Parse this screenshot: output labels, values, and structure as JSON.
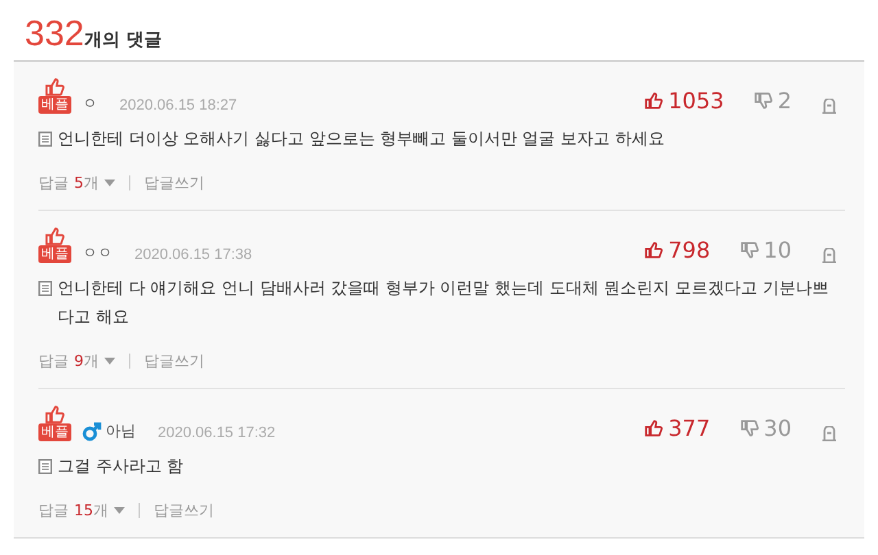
{
  "header": {
    "count": "332",
    "label": "개의 댓글"
  },
  "comments": [
    {
      "best": true,
      "badge": "베플",
      "nickname": "ㅇ",
      "male": false,
      "date": "2020.06.15 18:27",
      "likes": "1053",
      "dislikes": "2",
      "text": "언니한테 더이상 오해사기 싫다고 앞으로는 형부빼고 둘이서만 얼굴 보자고 하세요",
      "replies_label": "답글",
      "replies_count": "5",
      "replies_unit": "개",
      "write_reply": "답글쓰기"
    },
    {
      "best": true,
      "badge": "베플",
      "nickname": "ㅇㅇ",
      "male": false,
      "date": "2020.06.15 17:38",
      "likes": "798",
      "dislikes": "10",
      "text": "언니한테 다 얘기해요 언니 담배사러 갔을때 형부가 이런말 했는데 도대체 뭔소린지 모르겠다고 기분나쁘다고 해요",
      "replies_label": "답글",
      "replies_count": "9",
      "replies_unit": "개",
      "write_reply": "답글쓰기"
    },
    {
      "best": true,
      "badge": "베플",
      "nickname": "아님",
      "male": true,
      "date": "2020.06.15 17:32",
      "likes": "377",
      "dislikes": "30",
      "text": "그걸 주사라고 함",
      "replies_label": "답글",
      "replies_count": "15",
      "replies_unit": "개",
      "write_reply": "답글쓰기"
    }
  ]
}
